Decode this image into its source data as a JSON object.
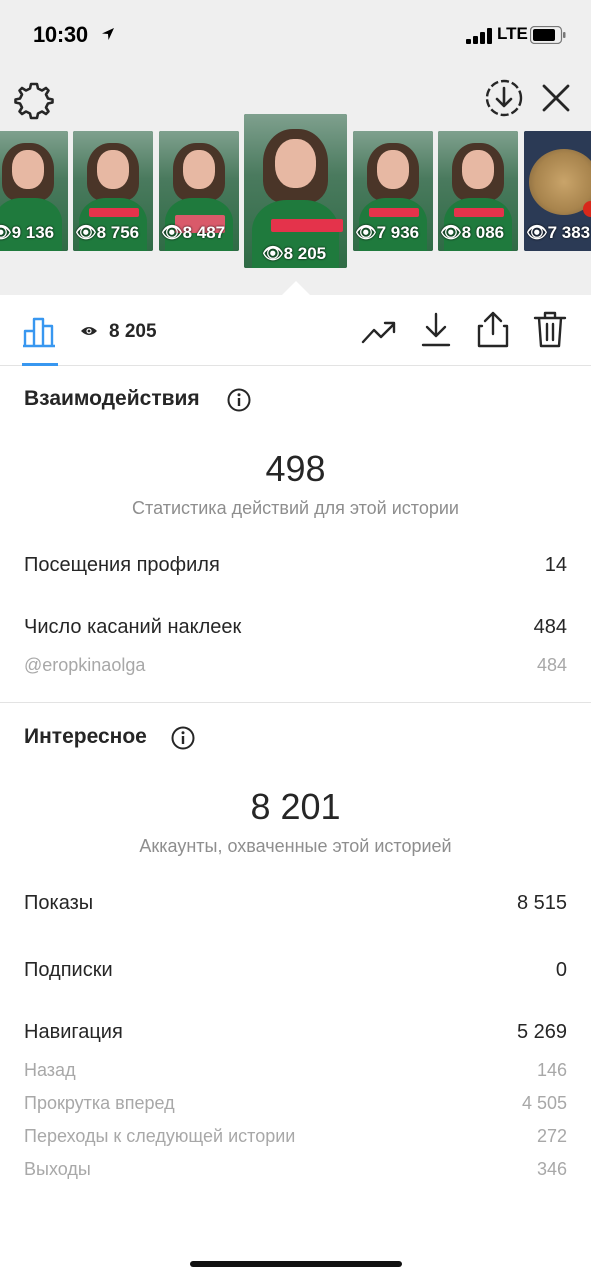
{
  "status_bar": {
    "time": "10:30",
    "network": "LTE"
  },
  "stories": [
    {
      "views": "9 136"
    },
    {
      "views": "8 756"
    },
    {
      "views": "8 487"
    },
    {
      "views": "8 205",
      "selected": true
    },
    {
      "views": "7 936"
    },
    {
      "views": "8 086"
    },
    {
      "views": "7 383"
    }
  ],
  "action_bar": {
    "views_count": "8 205"
  },
  "interactions": {
    "title": "Взаимодействия",
    "total": "498",
    "total_caption": "Статистика действий для этой истории",
    "rows": [
      {
        "label": "Посещения профиля",
        "value": "14"
      },
      {
        "label": "Число касаний наклеек",
        "value": "484"
      },
      {
        "label": "@eropkinaolga",
        "value": "484"
      }
    ]
  },
  "discovery": {
    "title": "Интересное",
    "reach": "8 201",
    "reach_caption": "Аккаунты, охваченные этой историей",
    "rows": [
      {
        "label": "Показы",
        "value": "8 515"
      },
      {
        "label": "Подписки",
        "value": "0"
      },
      {
        "label": "Навигация",
        "value": "5 269"
      },
      {
        "label": "Назад",
        "value": "146"
      },
      {
        "label": "Прокрутка вперед",
        "value": "4 505"
      },
      {
        "label": "Переходы к следующей истории",
        "value": "272"
      },
      {
        "label": "Выходы",
        "value": "346"
      }
    ]
  },
  "colors": {
    "accent": "#3897f0",
    "toolbar_bg": "#efefef",
    "muted_text": "#8e8e8e"
  }
}
